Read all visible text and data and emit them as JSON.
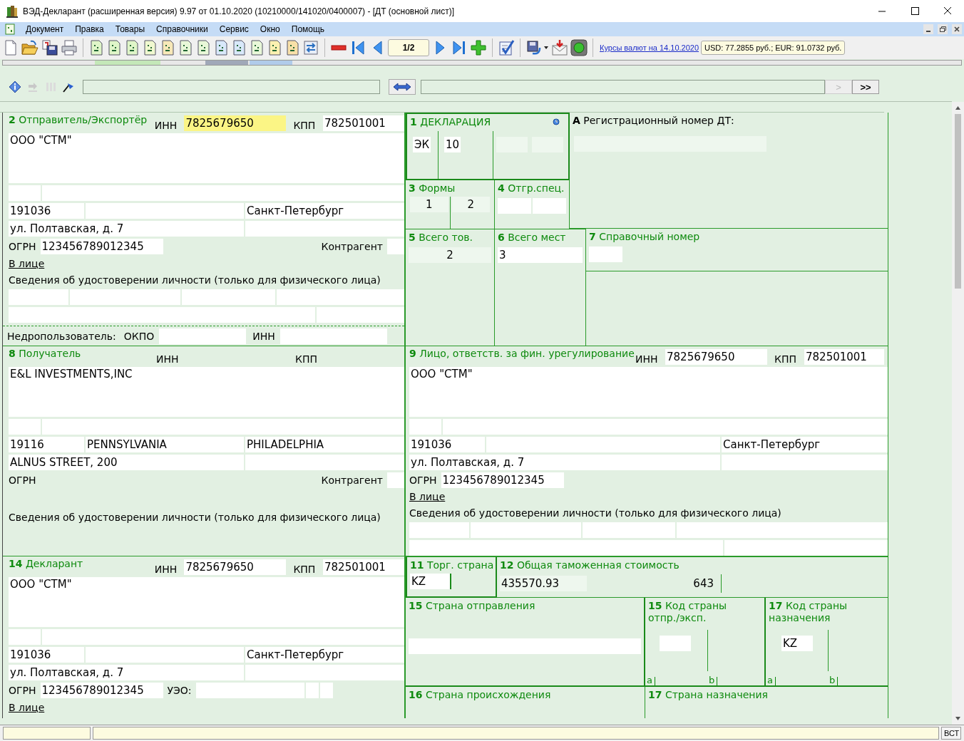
{
  "window": {
    "title": "ВЭД-Декларант (расширенная версия) 9.97 от 01.10.2020  (10210000/141020/0400007) - [ДТ (основной лист)]"
  },
  "menu": [
    {
      "label": "Документ"
    },
    {
      "label": "Правка"
    },
    {
      "label": "Товары"
    },
    {
      "label": "Справочники"
    },
    {
      "label": "Сервис"
    },
    {
      "label": "Окно"
    },
    {
      "label": "Помощь"
    }
  ],
  "toolbar": {
    "page": "1/2",
    "rates_link": "Курсы валют на 14.10.2020",
    "rates": "USD: 77.2855 руб.; EUR: 91.0732 руб."
  },
  "search_bar": {
    "buttons": [
      {
        "label": ">",
        "disabled": true
      },
      {
        "label": ">>",
        "disabled": false
      }
    ]
  },
  "form": {
    "sender": {
      "title": "**2** Отправитель/Экспортёр",
      "inn_label": "ИНН",
      "inn": "7825679650",
      "inn_highlighted": true,
      "kpp_label": "КПП",
      "kpp": "782501001",
      "name": "ООО \"СТМ\"",
      "postcode": "191036",
      "city": "Санкт-Петербург",
      "street": "ул. Полтавская, д. 7",
      "ogrn_label": "ОГРН",
      "ogrn": "123456789012345",
      "counterparty_label": "Контрагент",
      "person_link": "В лице",
      "id_label": "Сведения об удостоверении личности (только для физического лица)"
    },
    "subsoil_user": {
      "label": "Недропользователь:",
      "okpo_label": "ОКПО",
      "inn_label": "ИНН"
    },
    "declaration": {
      "title": "**1** ДЕКЛАРАЦИЯ",
      "type": "ЭК",
      "procedure": "10"
    },
    "registration": {
      "title": "**А** Регистрационный номер ДТ:"
    },
    "forms": {
      "title": "**3** Формы",
      "current": "1",
      "total": "2"
    },
    "loading_lists": {
      "title": "**4** Отгр.спец."
    },
    "total_goods": {
      "title": "**5** Всего тов.",
      "value": "2"
    },
    "total_places": {
      "title": "**6** Всего мест",
      "value": "3"
    },
    "reference_number": {
      "title": "**7** Справочный номер"
    },
    "consignee": {
      "title": "**8** Получатель",
      "inn_label": "ИНН",
      "kpp_label": "КПП",
      "name": "E&L INVESTMENTS,INC",
      "postcode": "19116",
      "region": "PENNSYLVANIA",
      "city": "PHILADELPHIA",
      "street": "ALNUS STREET, 200",
      "ogrn_label": "ОГРН",
      "counterparty_label": "Контрагент",
      "id_label": "Сведения об удостоверении личности (только для физического лица)"
    },
    "financial_party": {
      "title": "**9** Лицо, ответств. за фин. урегулирование",
      "inn_label": "ИНН",
      "inn": "7825679650",
      "inn_highlighted": false,
      "kpp_label": "КПП",
      "kpp": "782501001",
      "name": "ООО \"СТМ\"",
      "postcode": "191036",
      "city": "Санкт-Петербург",
      "street": "ул. Полтавская, д. 7",
      "ogrn_label": "ОГРН",
      "ogrn": "123456789012345",
      "person_link": "В лице",
      "id_label": "Сведения об удостоверении личности (только для физического лица)"
    },
    "declarant": {
      "title": "**14** Декларант",
      "inn_label": "ИНН",
      "inn": "7825679650",
      "inn_highlighted": false,
      "kpp_label": "КПП",
      "kpp": "782501001",
      "name": "ООО \"СТМ\"",
      "postcode": "191036",
      "city": "Санкт-Петербург",
      "street": "ул. Полтавская, д. 7",
      "ogrn_label": "ОГРН",
      "ogrn": "123456789012345",
      "ueo_label": "УЭО:",
      "person_link": "В лице"
    },
    "trading_country": {
      "title": "**11** Торг. страна",
      "value": "KZ"
    },
    "customs_value": {
      "title": "**12** Общая таможенная стоимость",
      "value": "435570.93",
      "currency": "643"
    },
    "dispatch_country": {
      "title": "**15** Страна отправления"
    },
    "dispatch_code": {
      "title": "**15** Код страны",
      "title_line2": "отпр./эксп.",
      "sub_a": "a",
      "sub_b": "b"
    },
    "destination_code": {
      "title": "**17** Код страны",
      "title_line2": "назначения",
      "value": "KZ",
      "sub_a": "a",
      "sub_b": "b"
    },
    "origin_country": {
      "title": "**16** Страна происхождения"
    },
    "destination_country": {
      "title": "**17** Страна назначения"
    }
  },
  "status_bar": {
    "mode": "ВСТ"
  }
}
